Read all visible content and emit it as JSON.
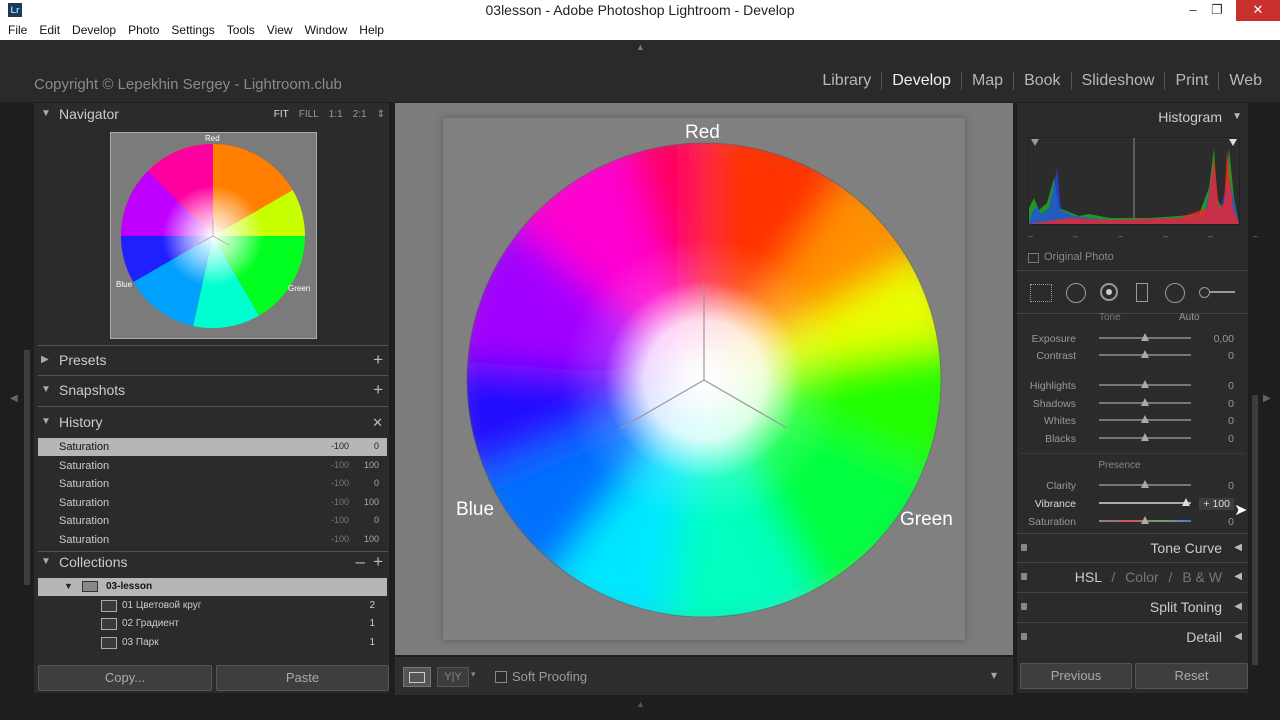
{
  "window": {
    "title": "03lesson - Adobe Photoshop Lightroom - Develop",
    "app_icon": "Lr",
    "minimize": "–",
    "restore": "❐",
    "close": "✕"
  },
  "menu": [
    "File",
    "Edit",
    "Develop",
    "Photo",
    "Settings",
    "Tools",
    "View",
    "Window",
    "Help"
  ],
  "header": {
    "copyright": "Copyright © Lepekhin Sergey - Lightroom.club"
  },
  "modules": [
    {
      "label": "Library",
      "active": false
    },
    {
      "label": "Develop",
      "active": true
    },
    {
      "label": "Map",
      "active": false
    },
    {
      "label": "Book",
      "active": false
    },
    {
      "label": "Slideshow",
      "active": false
    },
    {
      "label": "Print",
      "active": false
    },
    {
      "label": "Web",
      "active": false
    }
  ],
  "left_panel": {
    "navigator": {
      "title": "Navigator",
      "options": [
        "FIT",
        "FILL",
        "1:1",
        "2:1"
      ],
      "active_option": "FIT",
      "thumb_labels": {
        "red": "Red",
        "blue": "Blue",
        "green": "Green"
      }
    },
    "presets": {
      "title": "Presets",
      "action": "+"
    },
    "snapshots": {
      "title": "Snapshots",
      "action": "+"
    },
    "history": {
      "title": "History",
      "action": "✕",
      "items": [
        {
          "name": "Saturation",
          "v1": "-100",
          "v2": "0"
        },
        {
          "name": "Saturation",
          "v1": "-100",
          "v2": "100"
        },
        {
          "name": "Saturation",
          "v1": "-100",
          "v2": "0"
        },
        {
          "name": "Saturation",
          "v1": "-100",
          "v2": "100"
        },
        {
          "name": "Saturation",
          "v1": "-100",
          "v2": "0"
        },
        {
          "name": "Saturation",
          "v1": "-100",
          "v2": "100"
        }
      ]
    },
    "collections": {
      "title": "Collections",
      "actions": [
        "–",
        "+"
      ],
      "set": "03-lesson",
      "items": [
        {
          "name": "01 Цветовой круг",
          "count": "2"
        },
        {
          "name": "02 Градиент",
          "count": "1"
        },
        {
          "name": "03 Парк",
          "count": "1"
        }
      ]
    },
    "copy_button": "Copy...",
    "paste_button": "Paste"
  },
  "canvas": {
    "labels": {
      "red": "Red",
      "blue": "Blue",
      "green": "Green"
    }
  },
  "toolbar": {
    "soft_proofing": "Soft Proofing",
    "view_yy": "Y|Y"
  },
  "right_panel": {
    "histogram": {
      "title": "Histogram",
      "original_photo": "Original Photo"
    },
    "basic": {
      "tone_label": "Tone",
      "auto_label": "Auto",
      "tone": [
        {
          "label": "Exposure",
          "value": "0,00",
          "pos": 0.5
        },
        {
          "label": "Contrast",
          "value": "0",
          "pos": 0.5
        }
      ],
      "tone2": [
        {
          "label": "Highlights",
          "value": "0",
          "pos": 0.5
        },
        {
          "label": "Shadows",
          "value": "0",
          "pos": 0.5
        },
        {
          "label": "Whites",
          "value": "0",
          "pos": 0.5
        },
        {
          "label": "Blacks",
          "value": "0",
          "pos": 0.5
        }
      ],
      "presence_label": "Presence",
      "presence": [
        {
          "label": "Clarity",
          "value": "0",
          "pos": 0.5,
          "hi": false
        },
        {
          "label": "Vibrance",
          "value": "+ 100",
          "pos": 0.95,
          "hi": true
        },
        {
          "label": "Saturation",
          "value": "0",
          "pos": 0.5,
          "hi": false
        }
      ]
    },
    "sections": {
      "tone_curve": "Tone Curve",
      "hsl": "HSL",
      "color": "Color",
      "bw": "B & W",
      "split_toning": "Split Toning",
      "detail": "Detail"
    },
    "previous_button": "Previous",
    "reset_button": "Reset"
  }
}
